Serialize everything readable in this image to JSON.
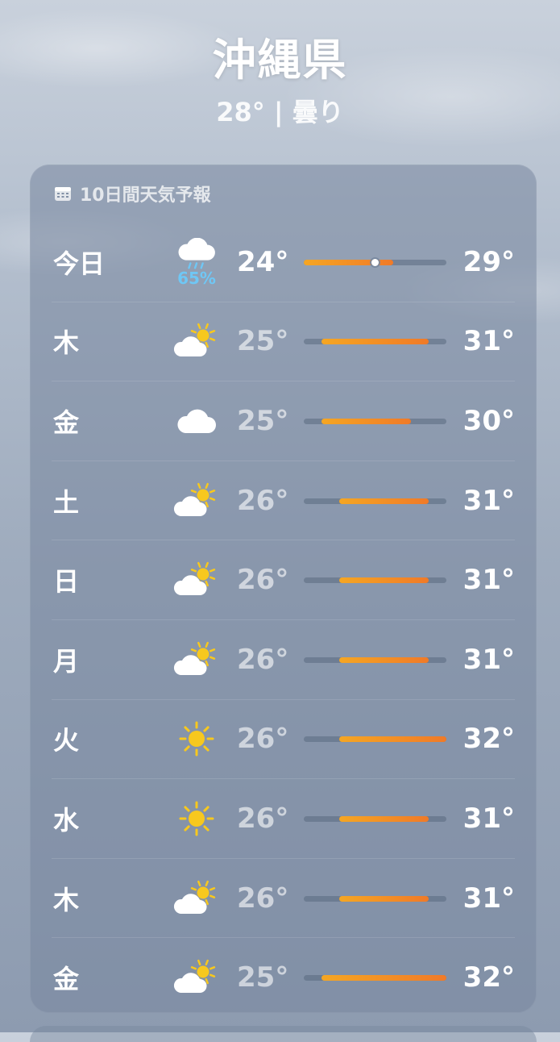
{
  "location": {
    "city": "沖縄県",
    "summary": "28° | 曇り"
  },
  "forecast": {
    "title": "10日間天気予報",
    "icon": "calendar-icon",
    "range": {
      "min": 24,
      "max": 32
    },
    "days": [
      {
        "day": "今日",
        "icon": "cloud-rain-icon",
        "precip": "65%",
        "low": "24°",
        "high": "29°",
        "low_v": 24,
        "high_v": 29,
        "current_v": 28
      },
      {
        "day": "木",
        "icon": "partly-sunny-icon",
        "low": "25°",
        "high": "31°",
        "low_v": 25,
        "high_v": 31
      },
      {
        "day": "金",
        "icon": "cloud-icon",
        "low": "25°",
        "high": "30°",
        "low_v": 25,
        "high_v": 30
      },
      {
        "day": "土",
        "icon": "partly-sunny-icon",
        "low": "26°",
        "high": "31°",
        "low_v": 26,
        "high_v": 31
      },
      {
        "day": "日",
        "icon": "partly-sunny-icon",
        "low": "26°",
        "high": "31°",
        "low_v": 26,
        "high_v": 31
      },
      {
        "day": "月",
        "icon": "partly-sunny-icon",
        "low": "26°",
        "high": "31°",
        "low_v": 26,
        "high_v": 31
      },
      {
        "day": "火",
        "icon": "sun-icon",
        "low": "26°",
        "high": "32°",
        "low_v": 26,
        "high_v": 32
      },
      {
        "day": "水",
        "icon": "sun-icon",
        "low": "26°",
        "high": "31°",
        "low_v": 26,
        "high_v": 31
      },
      {
        "day": "木",
        "icon": "partly-sunny-icon",
        "low": "26°",
        "high": "31°",
        "low_v": 26,
        "high_v": 31
      },
      {
        "day": "金",
        "icon": "partly-sunny-icon",
        "low": "25°",
        "high": "32°",
        "low_v": 25,
        "high_v": 32
      }
    ]
  },
  "colors": {
    "sun": "#f7c81e",
    "precip": "#6fc7f5",
    "bar_start": "#f5a623",
    "bar_end": "#f07a28"
  }
}
